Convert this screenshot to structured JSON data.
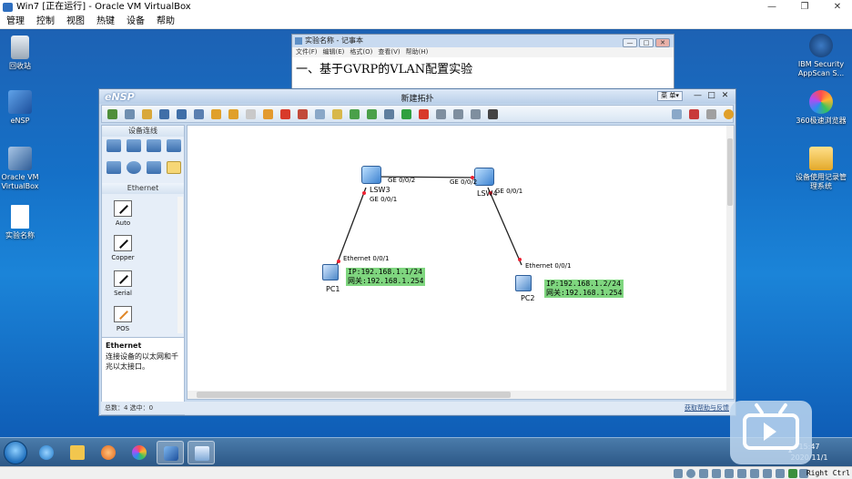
{
  "vbox": {
    "title": "Win7 [正在运行] - Oracle VM VirtualBox",
    "menu": [
      "管理",
      "控制",
      "视图",
      "热键",
      "设备",
      "帮助"
    ],
    "host_key": "Right Ctrl"
  },
  "desktop_icons": {
    "recycle": "回收站",
    "ensp": "eNSP",
    "vbox": "Oracle VM VirtualBox",
    "doc": "实验名称",
    "ibm": "IBM Security AppScan S...",
    "browser": "360极速浏览器",
    "mgmt": "设备使用记录管理系统"
  },
  "notepad": {
    "title": "实验名称 - 记事本",
    "menu": [
      "文件(F)",
      "编辑(E)",
      "格式(O)",
      "查看(V)",
      "帮助(H)"
    ],
    "content": "一、基于GVRP的VLAN配置实验"
  },
  "ensp": {
    "logo": "eNSP",
    "title": "新建拓扑",
    "menu_button": "菜 单▾",
    "panel_header": "设备连线",
    "panel_sub": "Ethernet",
    "cables": [
      "Auto",
      "Copper",
      "Serial",
      "POS"
    ],
    "desc_title": "Ethernet",
    "desc_text": "连接设备的以太网和千兆以太接口。",
    "status": "总数：4 选中：0",
    "help_link": "获取帮助与反馈"
  },
  "topology": {
    "nodes": {
      "lsw3": "LSW3",
      "lsw4": "LSW4",
      "pc1": "PC1",
      "pc2": "PC2"
    },
    "ports": {
      "lsw3_right": "GE 0/0/2",
      "lsw4_left": "GE 0/0/2",
      "lsw3_down": "GE 0/0/1",
      "lsw4_down": "GE 0/0/1",
      "pc1_eth": "Ethernet 0/0/1",
      "pc2_eth": "Ethernet 0/0/1"
    },
    "pc1_ip": "IP:192.168.1.1/24",
    "pc1_gw": "网关:192.168.1.254",
    "pc2_ip": "IP:192.168.1.2/24",
    "pc2_gw": "网关:192.168.1.254",
    "ip_box_color": "#7fd67f"
  },
  "taskbar": {
    "time": "15:47",
    "date": "2020/11/1"
  }
}
